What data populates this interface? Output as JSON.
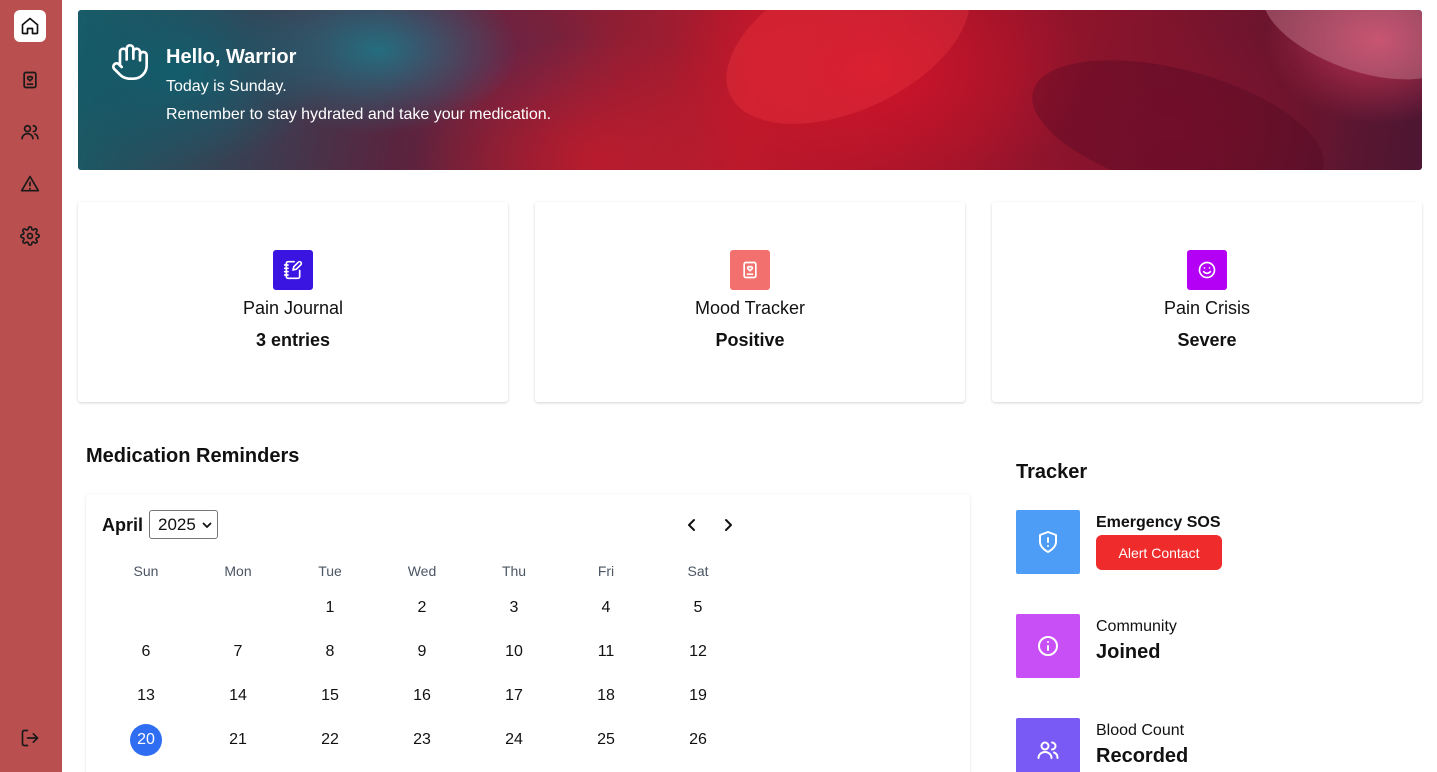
{
  "sidebar": {
    "items": [
      {
        "name": "home-icon"
      },
      {
        "name": "journal-icon"
      },
      {
        "name": "users-icon"
      },
      {
        "name": "alert-triangle-icon"
      },
      {
        "name": "gear-icon"
      }
    ],
    "logout": {
      "name": "logout-icon"
    },
    "background": "#b94f4f"
  },
  "banner": {
    "greeting": "Hello, Warrior",
    "today": "Today is Sunday.",
    "reminder": "Remember to stay hydrated and take your medication.",
    "icon": "waving-hand-icon"
  },
  "cards": [
    {
      "label": "Pain Journal",
      "value": "3 entries",
      "icon": "notebook-pen-icon",
      "color": "#3a14e0"
    },
    {
      "label": "Mood Tracker",
      "value": "Positive",
      "icon": "mood-book-icon",
      "color": "#f2706d"
    },
    {
      "label": "Pain Crisis",
      "value": "Severe",
      "icon": "smile-icon",
      "color": "#b400f5"
    }
  ],
  "medication": {
    "title": "Medication Reminders",
    "calendar": {
      "month": "April",
      "year": "2025",
      "weekdays": [
        "Sun",
        "Mon",
        "Tue",
        "Wed",
        "Thu",
        "Fri",
        "Sat"
      ],
      "days": [
        "1",
        "2",
        "3",
        "4",
        "5",
        "6",
        "7",
        "8",
        "9",
        "10",
        "11",
        "12",
        "13",
        "14",
        "15",
        "16",
        "17",
        "18",
        "19",
        "20",
        "21",
        "22",
        "23",
        "24",
        "25",
        "26"
      ],
      "selected_day": "20",
      "selected_color": "#2f6ef3"
    }
  },
  "tracker": {
    "title": "Tracker",
    "emergency": {
      "label": "Emergency SOS",
      "button": "Alert Contact",
      "icon": "shield-alert-icon",
      "color": "#4d9cf5",
      "button_color": "#ef2b2b"
    },
    "community": {
      "label": "Community",
      "value": "Joined",
      "icon": "info-icon",
      "color": "#c84ef5"
    },
    "blood": {
      "label": "Blood Count",
      "value": "Recorded",
      "icon": "users-icon",
      "color": "#7a5af5"
    }
  }
}
